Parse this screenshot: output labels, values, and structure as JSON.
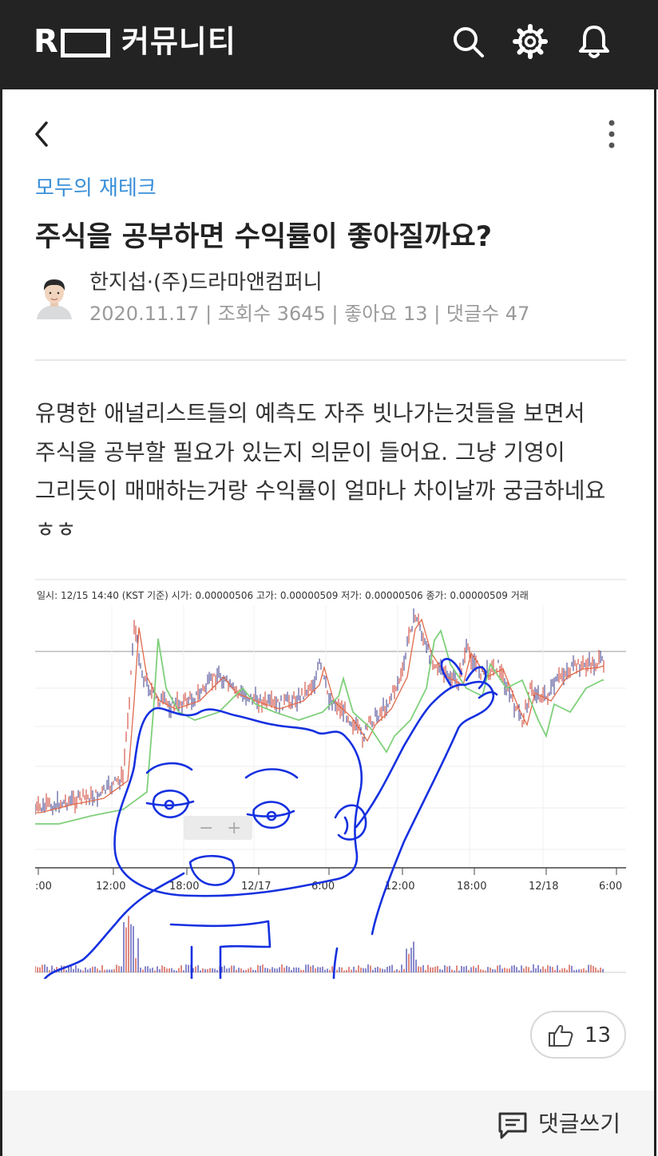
{
  "header": {
    "logo_letter": "R",
    "app_title": "커뮤니티",
    "icons": [
      "search-icon",
      "gear-icon",
      "bell-icon"
    ]
  },
  "post": {
    "category": "모두의 재테크",
    "title": "주식을 공부하면 수익률이 좋아질까요?",
    "author": "한지섭·(주)드라마앤컴퍼니",
    "date": "2020.11.17",
    "views_label": "조회수",
    "views": "3645",
    "likes_label": "좋아요",
    "likes": "13",
    "comments_label": "댓글수",
    "comments": "47",
    "body": "유명한 애널리스트들의 예측도 자주 빗나가는것들을 보면서 주식을 공부할 필요가 있는지 의문이 들어요. 그냥 기영이 그리듯이 매매하는거랑 수익률이 얼마나 차이날까 궁금하네요 ㅎㅎ"
  },
  "chart": {
    "info_line": "일시: 12/15 14:40 (KST 기준) 시가: 0.00000506 고가: 0.00000509 저가: 0.00000506 종가: 0.00000509 거래",
    "x_ticks": [
      ":00",
      "12:00",
      "18:00",
      "12/17",
      "6:00",
      "12:00",
      "18:00",
      "12/18",
      "6:00"
    ],
    "zoom_minus": "−",
    "zoom_plus": "+"
  },
  "actions": {
    "like_count": "13",
    "comment_button": "댓글쓰기"
  },
  "colors": {
    "topbar": "#232323",
    "category": "#3a8fd8",
    "meta": "#9a9a9a",
    "footer": "#f5f5f5",
    "drawing": "#1530e0"
  }
}
